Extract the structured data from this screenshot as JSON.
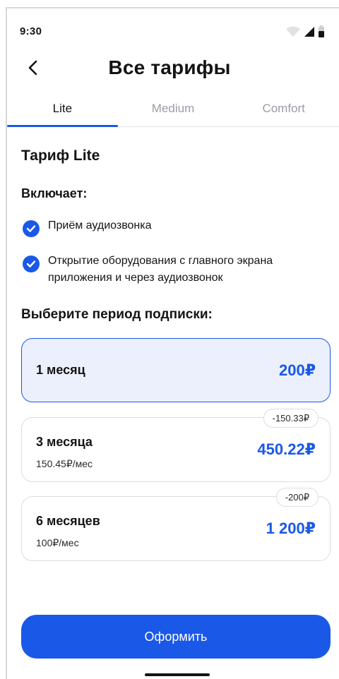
{
  "status_bar": {
    "time": "9:30",
    "icons": [
      "wifi-icon",
      "signal-icon",
      "battery-icon"
    ]
  },
  "header": {
    "title": "Все тарифы",
    "back_icon": "chevron-left-icon"
  },
  "tabs": [
    {
      "label": "Lite",
      "active": true
    },
    {
      "label": "Medium",
      "active": false
    },
    {
      "label": "Comfort",
      "active": false
    }
  ],
  "plan": {
    "name": "Тариф Lite",
    "includes_label": "Включает:",
    "features": [
      "Приём аудиозвонка",
      "Открытие оборудования с главного экрана приложения и через аудиозвонок"
    ]
  },
  "period": {
    "title": "Выберите период подписки:",
    "options": [
      {
        "name": "1 месяц",
        "price": "200₽",
        "sub": "",
        "badge": "",
        "selected": true
      },
      {
        "name": "3 месяца",
        "price": "450.22₽",
        "sub": "150.45₽/мес",
        "badge": "-150.33₽",
        "selected": false
      },
      {
        "name": "6 месяцев",
        "price": "1 200₽",
        "sub": "100₽/мес",
        "badge": "-200₽",
        "selected": false
      }
    ]
  },
  "cta": {
    "label": "Оформить"
  },
  "colors": {
    "accent": "#1a58e8",
    "selected_bg": "#ebf0fc",
    "border": "#dcdce3",
    "muted_text": "#9c9ca4"
  }
}
